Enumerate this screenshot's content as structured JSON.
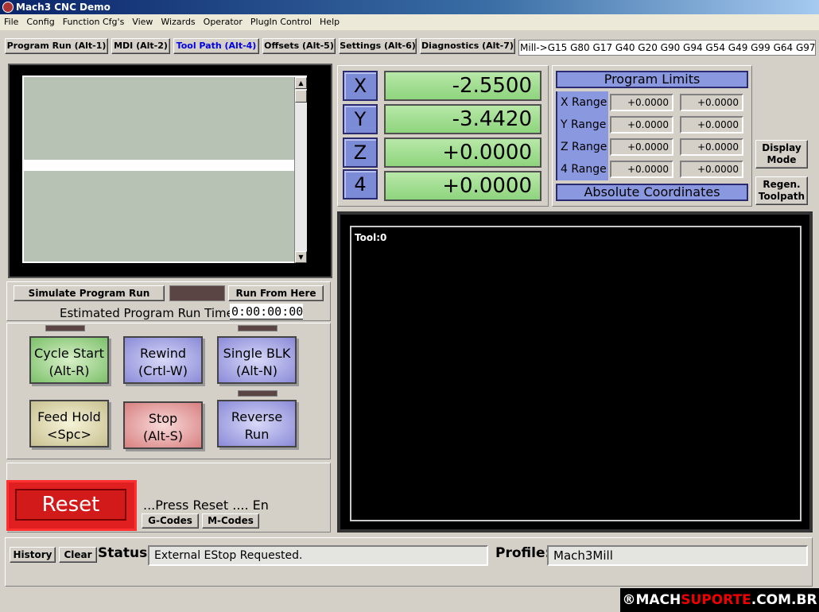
{
  "title": "Mach3 CNC  Demo",
  "menu": [
    "File",
    "Config",
    "Function Cfg's",
    "View",
    "Wizards",
    "Operator",
    "PlugIn Control",
    "Help"
  ],
  "tabs": [
    "Program Run (Alt-1)",
    "MDI (Alt-2)",
    "Tool Path (Alt-4)",
    "Offsets (Alt-5)",
    "Settings (Alt-6)",
    "Diagnostics (Alt-7)"
  ],
  "active_tab": "Tool Path (Alt-4)",
  "gcodes": "Mill->G15  G80 G17 G40 G20 G90 G94 G54 G49 G99 G64 G97",
  "simulate_label": "Simulate Program Run",
  "run_from_here_label": "Run From Here",
  "est_time_label": "Estimated Program Run Time",
  "est_time_value": "0:00:00:00",
  "buttons": {
    "cycle_start": [
      "Cycle Start",
      "(Alt-R)"
    ],
    "rewind": [
      "Rewind",
      "(Crtl-W)"
    ],
    "single_blk": [
      "Single BLK",
      "(Alt-N)"
    ],
    "feed_hold": [
      "Feed Hold",
      "<Spc>"
    ],
    "stop": [
      "Stop",
      "(Alt-S)"
    ],
    "reverse_run": [
      "Reverse",
      "Run"
    ]
  },
  "reset_label": "Reset",
  "reset_message": "...Press Reset .... En",
  "gcodes_btn": "G-Codes",
  "mcodes_btn": "M-Codes",
  "axes": [
    {
      "name": "X",
      "value": "-2.5500"
    },
    {
      "name": "Y",
      "value": "-3.4420"
    },
    {
      "name": "Z",
      "value": "+0.0000"
    },
    {
      "name": "4",
      "value": "+0.0000"
    }
  ],
  "limits": {
    "title": "Program Limits",
    "rows": [
      {
        "label": "X Range",
        "min": "+0.0000",
        "max": "+0.0000"
      },
      {
        "label": "Y Range",
        "min": "+0.0000",
        "max": "+0.0000"
      },
      {
        "label": "Z Range",
        "min": "+0.0000",
        "max": "+0.0000"
      },
      {
        "label": "4 Range",
        "min": "+0.0000",
        "max": "+0.0000"
      }
    ],
    "coords_label": "Absolute Coordinates"
  },
  "display_mode": [
    "Display",
    "Mode"
  ],
  "regen_toolpath": [
    "Regen.",
    "Toolpath"
  ],
  "toolpath_tool": "Tool:0",
  "history_label": "History",
  "clear_label": "Clear",
  "status_label": "Status:",
  "status_value": "External EStop Requested.",
  "profile_label": "Profile:",
  "profile_value": "Mach3Mill",
  "watermark": {
    "pre": "®MACH",
    "accent": "SUPORTE",
    "post": ".COM.BR"
  },
  "colors": {
    "dro_green": "#a8e098",
    "axis_blue": "#7b8bd6",
    "reset_red": "#e02020"
  }
}
